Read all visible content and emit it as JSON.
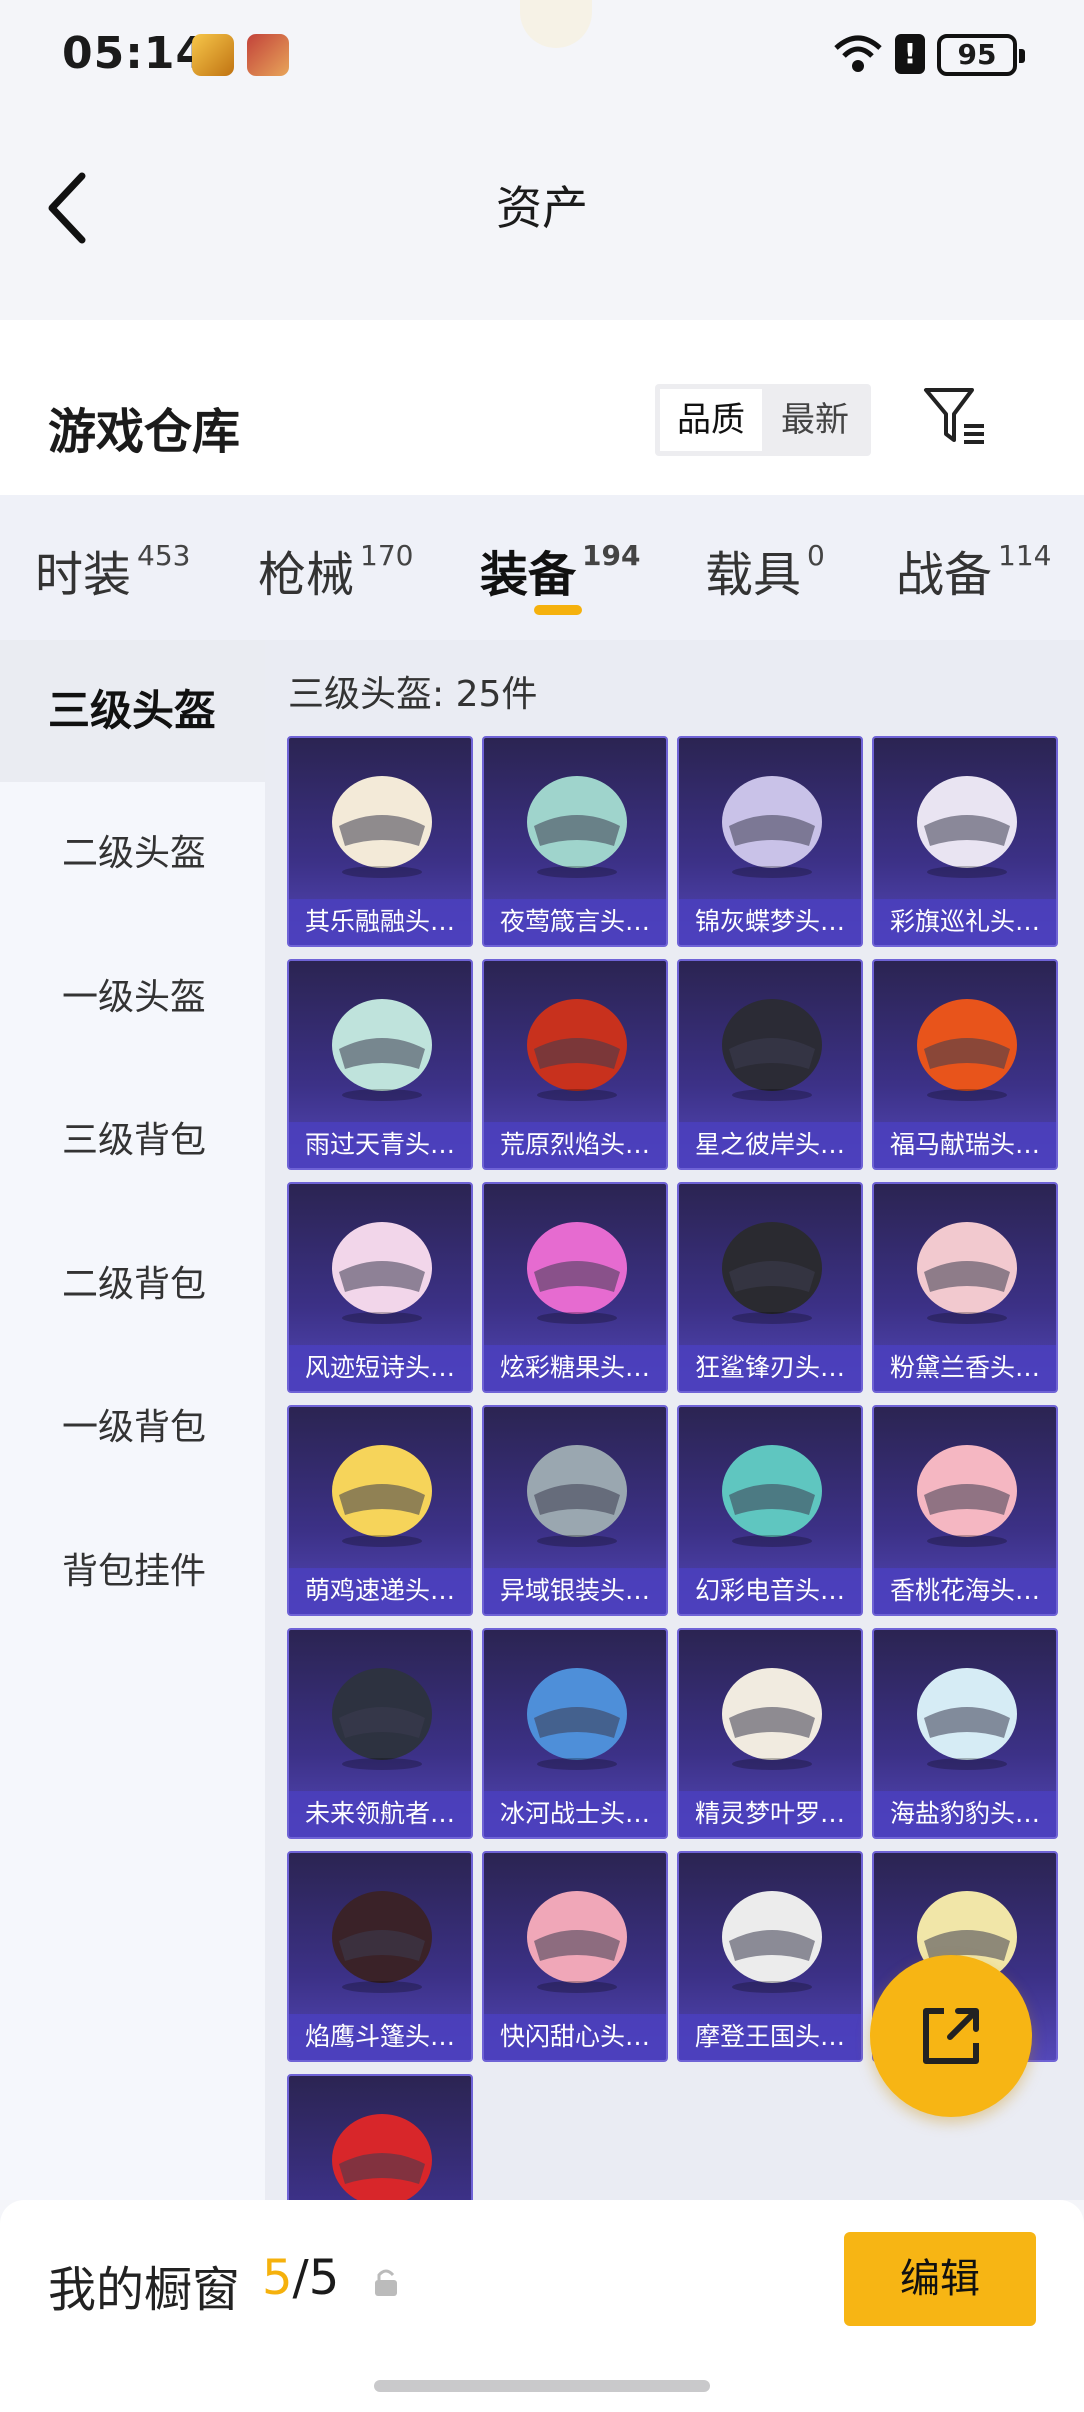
{
  "status_bar": {
    "time": "05:14",
    "battery": "95",
    "alert_glyph": "!"
  },
  "header": {
    "title": "资产"
  },
  "warehouse": {
    "title": "游戏仓库",
    "sort_options": [
      "品质",
      "最新"
    ],
    "selected_sort": "品质"
  },
  "category_tabs": [
    {
      "label": "时装",
      "count": "453"
    },
    {
      "label": "枪械",
      "count": "170"
    },
    {
      "label": "装备",
      "count": "194",
      "active": true
    },
    {
      "label": "载具",
      "count": "0"
    },
    {
      "label": "战备",
      "count": "114"
    }
  ],
  "sidebar": {
    "items": [
      "三级头盔",
      "二级头盔",
      "一级头盔",
      "三级背包",
      "二级背包",
      "一级背包",
      "背包挂件"
    ],
    "selected": "三级头盔"
  },
  "grid": {
    "count_label": "三级头盔: 25件",
    "items": [
      "其乐融融头…",
      "夜莺箴言头…",
      "锦灰蝶梦头…",
      "彩旗巡礼头…",
      "雨过天青头…",
      "荒原烈焰头…",
      "星之彼岸头…",
      "福马献瑞头…",
      "风迹短诗头…",
      "炫彩糖果头…",
      "狂鲨锋刃头…",
      "粉黛兰香头…",
      "萌鸡速递头…",
      "异域银装头…",
      "幻彩电音头…",
      "香桃花海头…",
      "未来领航者…",
      "冰河战士头…",
      "精灵梦叶罗…",
      "海盐豹豹头…",
      "焰鹰斗篷头…",
      "快闪甜心头…",
      "摩登王国头…",
      "",
      ""
    ],
    "helmet_colors": [
      "#f3ead8",
      "#9fd4cc",
      "#c9c2e8",
      "#e9e4f2",
      "#bfe3dc",
      "#c8311d",
      "#2b2b35",
      "#e8541b",
      "#f2d6ea",
      "#e66bd0",
      "#2a2a30",
      "#f2c9cf",
      "#f6d45a",
      "#9aa7b0",
      "#5fc6c0",
      "#f5b7c2",
      "#2d3240",
      "#4e8fd9",
      "#f1ebe0",
      "#d6ecf5",
      "#3a2228",
      "#f0a7b8",
      "#ececec",
      "#f1e6a8",
      "#d8262a"
    ]
  },
  "showcase": {
    "label": "我的橱窗",
    "current": "5",
    "total": "/5",
    "edit_label": "编辑"
  }
}
